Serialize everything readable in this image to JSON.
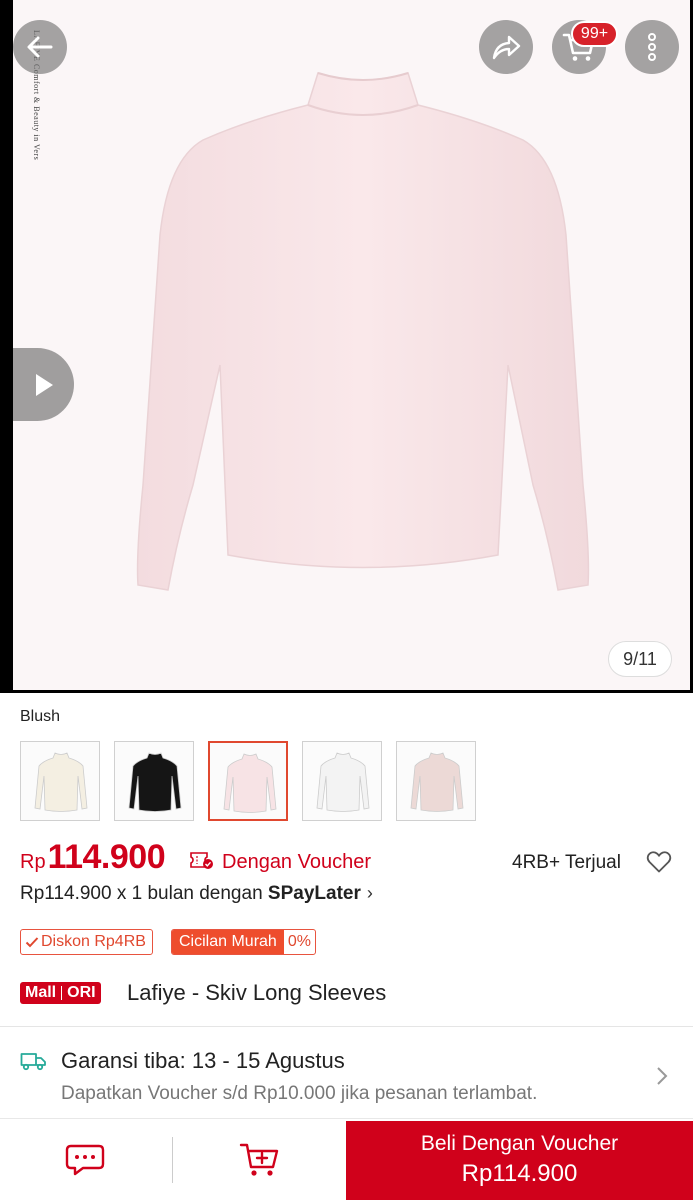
{
  "hero": {
    "image_counter": "9/11",
    "cart_badge": "99+",
    "brand_vertical_text": "LAFIYE  Comfort & Beauty in Versatility",
    "shirt_color": "#f7e3e5"
  },
  "icons": {
    "back": "back-arrow-icon",
    "share": "share-icon",
    "cart": "cart-icon",
    "more": "more-vertical-icon",
    "video": "play-icon",
    "voucher": "voucher-icon",
    "heart": "heart-icon",
    "truck": "truck-icon",
    "chat": "chat-icon",
    "add_cart": "add-to-cart-icon"
  },
  "variant": {
    "label": "Blush",
    "thumbs": [
      {
        "name": "cream",
        "color": "#f4efe2",
        "selected": false
      },
      {
        "name": "black",
        "color": "#151515",
        "selected": false
      },
      {
        "name": "blush",
        "color": "#f7e3e5",
        "selected": true
      },
      {
        "name": "white",
        "color": "#f3f3f3",
        "selected": false
      },
      {
        "name": "mauve",
        "color": "#ecd9d6",
        "selected": false
      }
    ]
  },
  "price": {
    "currency": "Rp",
    "value": "114.900",
    "voucher_text": "Dengan Voucher",
    "sold": "4RB+ Terjual"
  },
  "installment": {
    "prefix": "Rp114.900 x 1 bulan dengan ",
    "provider": "SPayLater",
    "chevron": "›"
  },
  "tags": {
    "discount": "Diskon Rp4RB",
    "installment_label": "Cicilan Murah",
    "installment_rate": "0%"
  },
  "product": {
    "mall_label": "Mall",
    "ori_label": "ORI",
    "title": "Lafiye - Skiv Long Sleeves"
  },
  "shipping": {
    "title": "Garansi tiba: 13 - 15 Agustus",
    "subtitle": "Dapatkan Voucher s/d Rp10.000 jika pesanan terlambat."
  },
  "bottom": {
    "buy_line1": "Beli Dengan Voucher",
    "buy_line2": "Rp114.900"
  },
  "colors": {
    "accent_red": "#d0011b",
    "orange": "#ee4d2d",
    "truck_teal": "#26aa99"
  }
}
